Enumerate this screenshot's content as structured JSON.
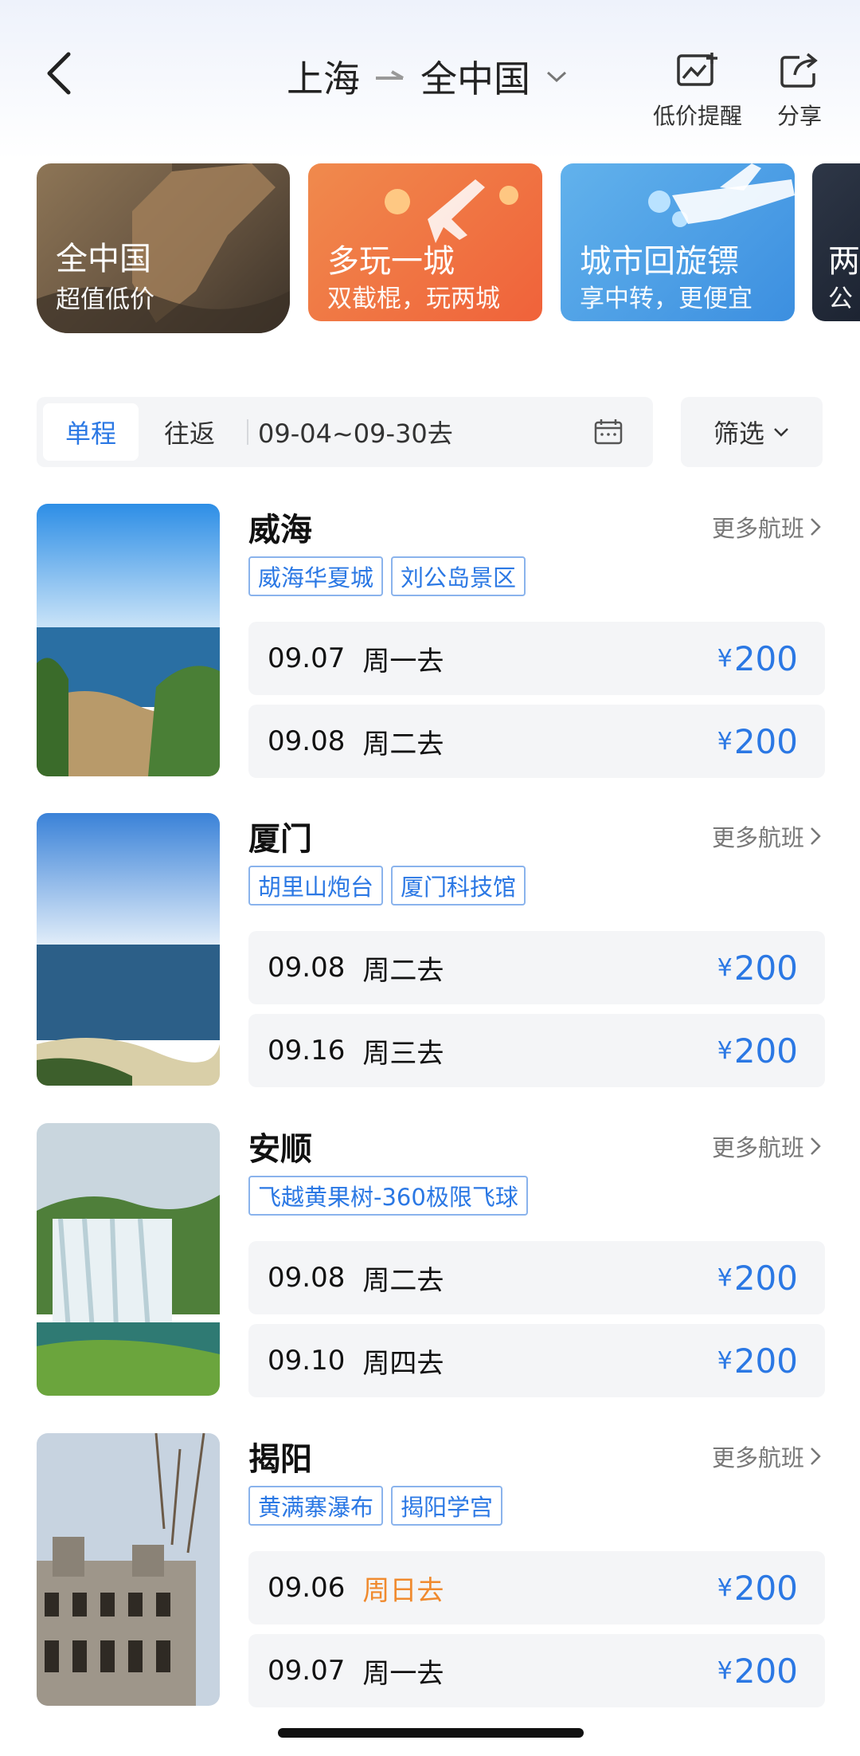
{
  "header": {
    "origin": "上海",
    "destination": "全中国",
    "alert_label": "低价提醒",
    "share_label": "分享"
  },
  "promos": [
    {
      "title": "全中国",
      "subtitle": "超值低价"
    },
    {
      "title": "多玩一城",
      "subtitle": "双截棍，玩两城"
    },
    {
      "title": "城市回旋镖",
      "subtitle": "享中转，更便宜"
    },
    {
      "title": "两",
      "subtitle": "公"
    }
  ],
  "filters": {
    "one_way": "单程",
    "round_trip": "往返",
    "date_range": "09-04~09-30去",
    "filter_label": "筛选",
    "active_tab": "单程"
  },
  "more_flights_label": "更多航班",
  "currency": "¥",
  "destinations": [
    {
      "city": "威海",
      "tags": [
        "威海华夏城",
        "刘公岛景区"
      ],
      "flights": [
        {
          "date": "09.07",
          "weekday": "周一去",
          "price": "200"
        },
        {
          "date": "09.08",
          "weekday": "周二去",
          "price": "200"
        }
      ]
    },
    {
      "city": "厦门",
      "tags": [
        "胡里山炮台",
        "厦门科技馆"
      ],
      "flights": [
        {
          "date": "09.08",
          "weekday": "周二去",
          "price": "200"
        },
        {
          "date": "09.16",
          "weekday": "周三去",
          "price": "200"
        }
      ]
    },
    {
      "city": "安顺",
      "tags": [
        "飞越黄果树-360极限飞球"
      ],
      "flights": [
        {
          "date": "09.08",
          "weekday": "周二去",
          "price": "200"
        },
        {
          "date": "09.10",
          "weekday": "周四去",
          "price": "200"
        }
      ]
    },
    {
      "city": "揭阳",
      "tags": [
        "黄满寨瀑布",
        "揭阳学宫"
      ],
      "flights": [
        {
          "date": "09.06",
          "weekday": "周日去",
          "price": "200"
        },
        {
          "date": "09.07",
          "weekday": "周一去",
          "price": "200"
        }
      ]
    }
  ],
  "colors": {
    "accent": "#2b78e4",
    "weekend": "#f08a2e",
    "row_bg": "#f4f5f7"
  }
}
